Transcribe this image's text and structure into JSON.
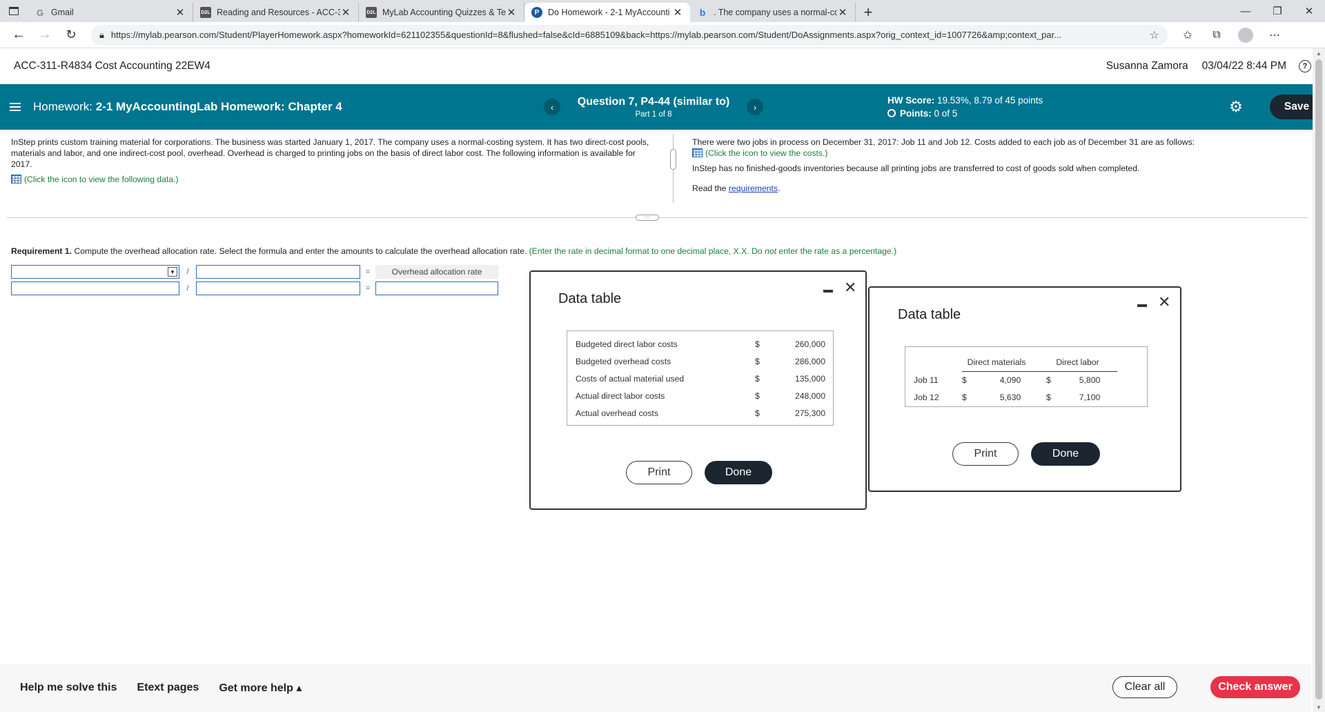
{
  "browser": {
    "tabs": [
      {
        "title": "Gmail",
        "favicon": "G",
        "type": "g"
      },
      {
        "title": "Reading and Resources - ACC-31",
        "favicon": "D2L",
        "type": "d2l"
      },
      {
        "title": "MyLab Accounting Quizzes & Te",
        "favicon": "D2L",
        "type": "d2l"
      },
      {
        "title": "Do Homework - 2-1 MyAccounti",
        "favicon": "P",
        "type": "p",
        "active": true
      },
      {
        "title": ". The company uses a normal-co",
        "favicon": "b",
        "type": "b"
      }
    ],
    "url": "https://mylab.pearson.com/Student/PlayerHomework.aspx?homeworkId=621102355&questionId=8&flushed=false&cId=6885109&back=https://mylab.pearson.com/Student/DoAssignments.aspx?orig_context_id=1007726&amp;context_par..."
  },
  "course": {
    "name": "ACC-311-R4834 Cost Accounting 22EW4",
    "user": "Susanna Zamora",
    "datetime": "03/04/22 8:44 PM",
    "help": "?"
  },
  "homework": {
    "prefix": "Homework:",
    "title": "2-1 MyAccountingLab Homework: Chapter 4",
    "question": "Question 7, P4-44 (similar to)",
    "part": "Part 1 of 8",
    "hw_score_label": "HW Score:",
    "hw_score_value": "19.53%, 8.79 of 45 points",
    "points_label": "Points:",
    "points_value": "0 of 5",
    "save_label": "Save"
  },
  "problem": {
    "left_text": "InStep prints custom training material for corporations. The business was started January 1, 2017. The company uses a normal-costing system. It has two direct-cost pools, materials and labor, and one indirect-cost pool, overhead. Overhead is charged to printing jobs on the basis of direct labor cost. The following information is available for 2017.",
    "left_link": "(Click the icon to view the following data.)",
    "right_text1": "There were two jobs in process on December 31, 2017: Job 11 and Job 12. Costs added to each job as of December 31 are as follows:",
    "right_link": "(Click the icon to view the costs.)",
    "right_text2": "InStep has no finished-goods inventories because all printing jobs are transferred to cost of goods sold when completed.",
    "read_prefix": "Read the",
    "requirements_link": "requirements",
    "read_suffix": "."
  },
  "requirement": {
    "label": "Requirement 1.",
    "text": "Compute the overhead allocation rate. Select the formula and enter the amounts to calculate the overhead allocation rate.",
    "hint_a": "(Enter the rate in decimal format to one decimal place, X.X. Do",
    "hint_not": "not",
    "hint_b": "enter the rate as a percentage.)",
    "slash": "/",
    "equals": "=",
    "result_label": "Overhead allocation rate"
  },
  "popup1": {
    "title": "Data table",
    "rows": [
      {
        "label": "Budgeted direct labor costs",
        "cur": "$",
        "value": "260,000"
      },
      {
        "label": "Budgeted overhead costs",
        "cur": "$",
        "value": "286,000"
      },
      {
        "label": "Costs of actual material used",
        "cur": "$",
        "value": "135,000"
      },
      {
        "label": "Actual direct labor costs",
        "cur": "$",
        "value": "248,000"
      },
      {
        "label": "Actual overhead costs",
        "cur": "$",
        "value": "275,300"
      }
    ],
    "print_label": "Print",
    "done_label": "Done"
  },
  "popup2": {
    "title": "Data table",
    "headers": [
      "Direct materials",
      "Direct labor"
    ],
    "rows": [
      {
        "job": "Job 11",
        "cur1": "$",
        "dm": "4,090",
        "cur2": "$",
        "dl": "5,800"
      },
      {
        "job": "Job 12",
        "cur1": "$",
        "dm": "5,630",
        "cur2": "$",
        "dl": "7,100"
      }
    ],
    "print_label": "Print",
    "done_label": "Done"
  },
  "footer": {
    "help_me": "Help me solve this",
    "etext": "Etext pages",
    "more_help": "Get more help ▴",
    "clear_all": "Clear all",
    "check_answer": "Check answer"
  }
}
